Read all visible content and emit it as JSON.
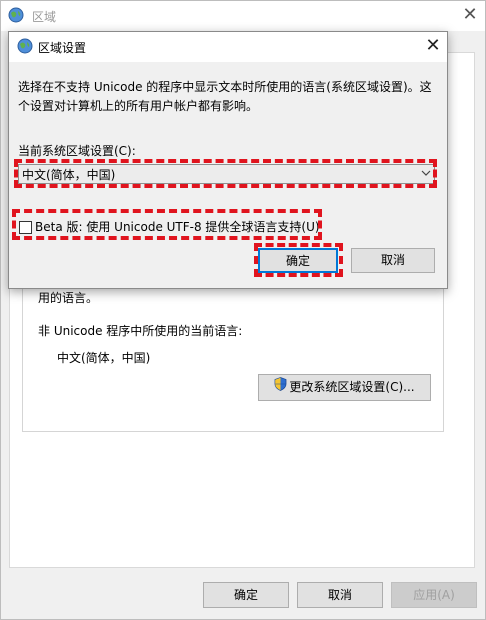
{
  "outer_window": {
    "title": "区域",
    "close_glyph": "✕",
    "unicode_desc_tail": "用的语言。",
    "non_unicode_label": "非 Unicode 程序中所使用的当前语言:",
    "current_language": "中文(简体，中国)",
    "change_locale_button": "更改系统区域设置(C)...",
    "ok_button": "确定",
    "cancel_button": "取消",
    "apply_button": "应用(A)"
  },
  "dialog": {
    "title": "区域设置",
    "close_glyph": "✕",
    "description": "选择在不支持 Unicode 的程序中显示文本时所使用的语言(系统区域设置)。这个设置对计算机上的所有用户帐户都有影响。",
    "locale_label": "当前系统区域设置(C):",
    "locale_value": "中文(简体，中国)",
    "beta_checkbox_label": "Beta 版: 使用 Unicode UTF-8 提供全球语言支持(U)",
    "beta_checked": false,
    "ok_button": "确定",
    "cancel_button": "取消"
  },
  "icons": {
    "outer_window_icon": "globe-icon",
    "dialog_icon": "globe-icon",
    "change_locale_icon": "shield-icon",
    "select_dropdown_icon": "chevron-down-icon"
  },
  "colors": {
    "highlight": "#e0141e",
    "focus_border": "#0078d7"
  }
}
